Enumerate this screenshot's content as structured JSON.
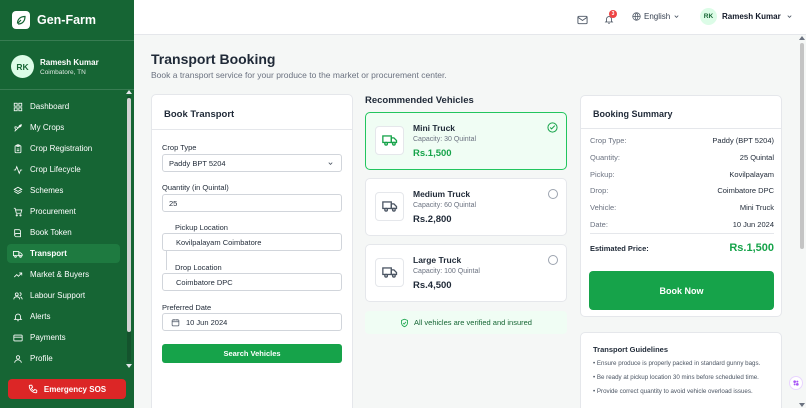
{
  "brand": {
    "name": "Gen-Farm"
  },
  "user": {
    "initials": "RK",
    "name": "Ramesh Kumar",
    "location": "Coimbatore, TN"
  },
  "nav": {
    "items": [
      {
        "label": "Dashboard",
        "icon": "dashboard-icon"
      },
      {
        "label": "My Crops",
        "icon": "sprout-icon"
      },
      {
        "label": "Crop Registration",
        "icon": "clipboard-icon"
      },
      {
        "label": "Crop Lifecycle",
        "icon": "pulse-icon"
      },
      {
        "label": "Schemes",
        "icon": "layers-icon"
      },
      {
        "label": "Procurement",
        "icon": "cart-icon"
      },
      {
        "label": "Book Token",
        "icon": "book-icon"
      },
      {
        "label": "Transport",
        "icon": "truck-icon",
        "active": true
      },
      {
        "label": "Market & Buyers",
        "icon": "trend-icon"
      },
      {
        "label": "Labour Support",
        "icon": "users-icon"
      },
      {
        "label": "Alerts",
        "icon": "bell-icon"
      },
      {
        "label": "Payments",
        "icon": "card-icon"
      },
      {
        "label": "Profile",
        "icon": "user-icon"
      }
    ]
  },
  "sos": {
    "label": "Emergency SOS"
  },
  "header": {
    "notification_count": "3",
    "language": "English",
    "user_initials": "RK",
    "user_name": "Ramesh Kumar"
  },
  "page": {
    "title": "Transport Booking",
    "subtitle": "Book a transport service for your produce to the market or procurement center."
  },
  "book_form": {
    "title": "Book Transport",
    "crop_type_label": "Crop Type",
    "crop_type_value": "Paddy BPT 5204",
    "quantity_label": "Quantity (in Quintal)",
    "quantity_value": "25",
    "pickup_label": "Pickup Location",
    "pickup_value": "Kovilpalayam Coimbatore",
    "drop_label": "Drop Location",
    "drop_value": "Coimbatore DPC",
    "date_label": "Preferred Date",
    "date_value": "10 Jun 2024",
    "search_label": "Search Vehicles"
  },
  "vehicles": {
    "title": "Recommended Vehicles",
    "items": [
      {
        "name": "Mini Truck",
        "capacity": "Capacity: 30 Quintal",
        "price": "Rs.1,500",
        "selected": true
      },
      {
        "name": "Medium Truck",
        "capacity": "Capacity: 60 Quintal",
        "price": "Rs.2,800",
        "selected": false
      },
      {
        "name": "Large Truck",
        "capacity": "Capacity: 100 Quintal",
        "price": "Rs.4,500",
        "selected": false
      }
    ],
    "verified_note": "All vehicles are verified and insured"
  },
  "summary": {
    "title": "Booking Summary",
    "rows": [
      {
        "key": "Crop Type:",
        "value": "Paddy (BPT 5204)"
      },
      {
        "key": "Quantity:",
        "value": "25 Quintal"
      },
      {
        "key": "Pickup:",
        "value": "Kovilpalayam"
      },
      {
        "key": "Drop:",
        "value": "Coimbatore DPC"
      },
      {
        "key": "Vehicle:",
        "value": "Mini Truck"
      },
      {
        "key": "Date:",
        "value": "10 Jun 2024"
      }
    ],
    "estimated_label": "Estimated Price:",
    "estimated_value": "Rs.1,500",
    "book_now_label": "Book Now"
  },
  "guidelines": {
    "title": "Transport Guidelines",
    "items": [
      "• Ensure produce is properly packed in standard gunny bags.",
      "• Be ready at pickup location 30 mins before scheduled time.",
      "• Provide correct quantity to avoid vehicle overload issues."
    ]
  },
  "colors": {
    "brand": "#166534",
    "accent": "#16a34a",
    "sos": "#dc2626"
  }
}
